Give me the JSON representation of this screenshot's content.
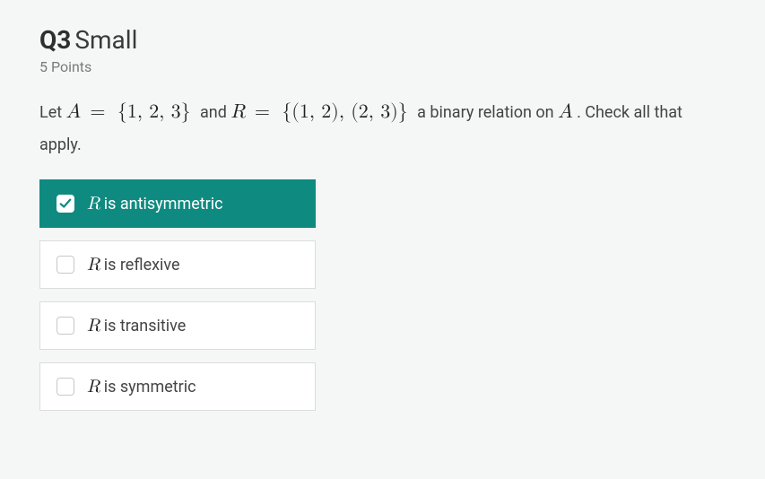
{
  "question": {
    "number": "Q3",
    "title": "Small",
    "points": "5 Points"
  },
  "prompt": {
    "pre": "Let ",
    "setA_lhs": "A",
    "eq": " = ",
    "setA_rhs": "{1, 2, 3}",
    "and": " and ",
    "setR_lhs": "R",
    "setR_rhs": "{(1, 2), (2, 3)}",
    "post1": " a binary relation on ",
    "post2": ". Check all that apply."
  },
  "options": [
    {
      "var": "R",
      "text": " is antisymmetric",
      "checked": true
    },
    {
      "var": "R",
      "text": " is reflexive",
      "checked": false
    },
    {
      "var": "R",
      "text": " is transitive",
      "checked": false
    },
    {
      "var": "R",
      "text": " is symmetric",
      "checked": false
    }
  ]
}
